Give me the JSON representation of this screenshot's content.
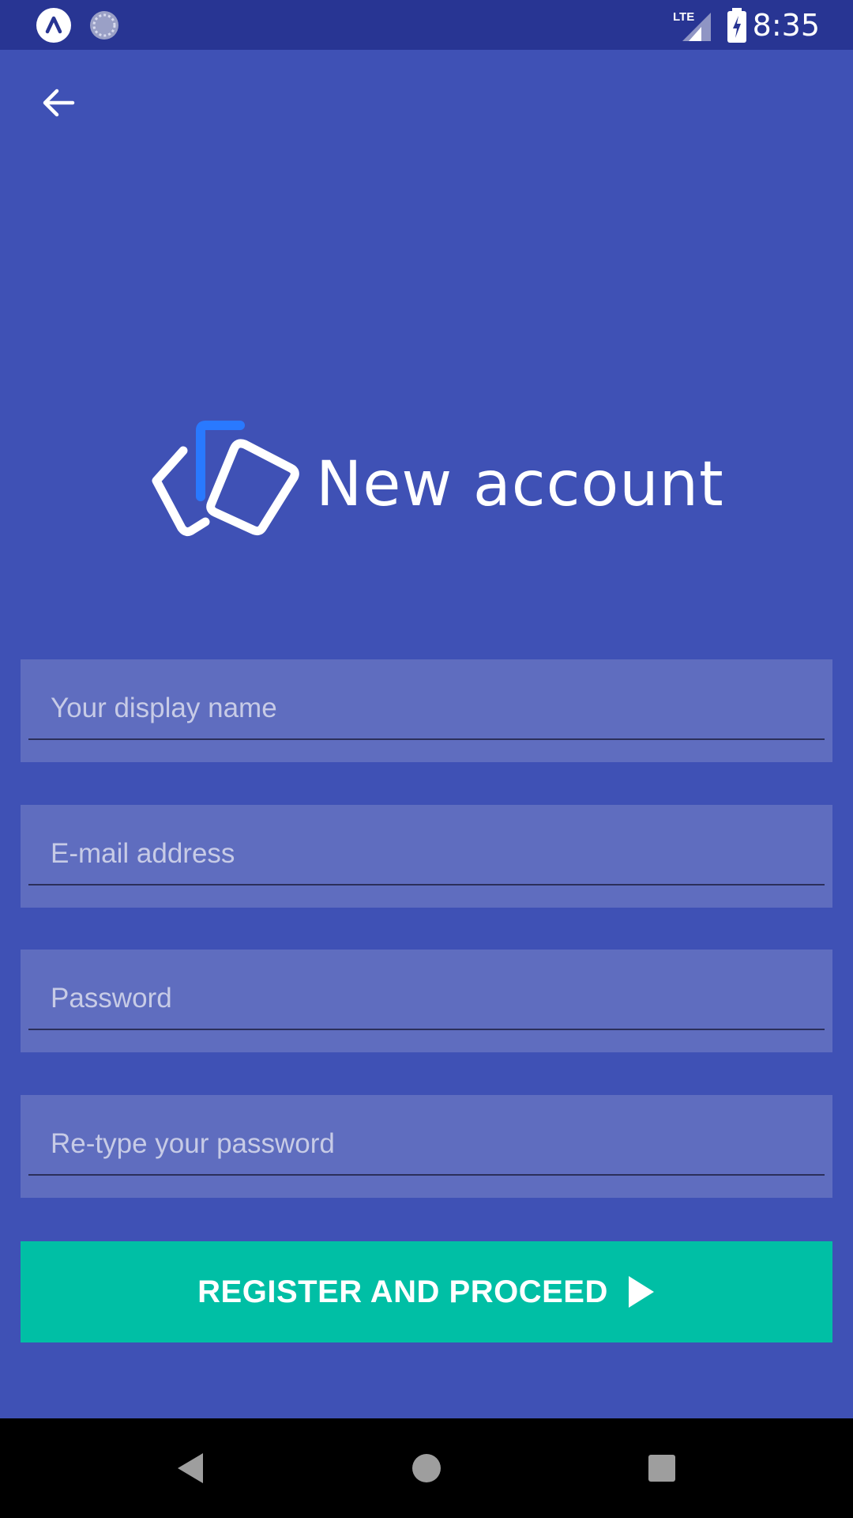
{
  "status_bar": {
    "time": "8:35",
    "network_label": "LTE",
    "icons": [
      "app-notification-icon",
      "sync-icon",
      "lte-signal-icon",
      "battery-charging-icon"
    ]
  },
  "header": {
    "back_icon": "arrow-left-icon"
  },
  "branding": {
    "logo_icon": "cards-logo-icon",
    "title": "New account",
    "accent_color": "#2979ff"
  },
  "form": {
    "display_name": {
      "placeholder": "Your display name",
      "value": ""
    },
    "email": {
      "placeholder": "E-mail address",
      "value": ""
    },
    "password": {
      "placeholder": "Password",
      "value": ""
    },
    "retype_password": {
      "placeholder": "Re-type your password",
      "value": ""
    }
  },
  "actions": {
    "register_label": "REGISTER AND PROCEED",
    "register_icon": "play-icon"
  },
  "colors": {
    "background": "#3f51b5",
    "status_bar": "#283593",
    "field_bg": "#5f6dbf",
    "button": "#00bfa5"
  },
  "nav_bar": {
    "icons": [
      "nav-back-icon",
      "nav-home-icon",
      "nav-recents-icon"
    ]
  }
}
